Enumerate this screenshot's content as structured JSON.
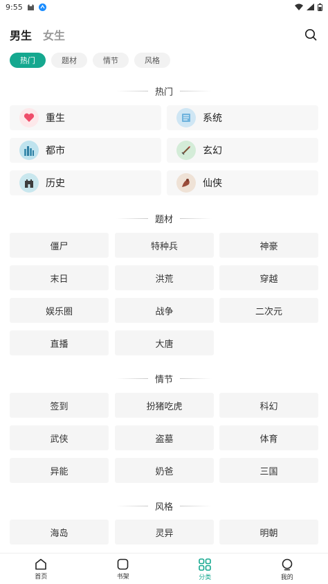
{
  "status": {
    "time": "9:55"
  },
  "gender_tabs": [
    {
      "label": "男生",
      "active": true
    },
    {
      "label": "女生",
      "active": false
    }
  ],
  "category_chips": [
    {
      "label": "热门",
      "active": true
    },
    {
      "label": "题材",
      "active": false
    },
    {
      "label": "情节",
      "active": false
    },
    {
      "label": "风格",
      "active": false
    }
  ],
  "sections": {
    "hot": {
      "title": "热门",
      "items": [
        "重生",
        "系统",
        "都市",
        "玄幻",
        "历史",
        "仙侠"
      ]
    },
    "theme": {
      "title": "题材",
      "items": [
        "僵尸",
        "特种兵",
        "神豪",
        "末日",
        "洪荒",
        "穿越",
        "娱乐圈",
        "战争",
        "二次元",
        "直播",
        "大唐"
      ]
    },
    "plot": {
      "title": "情节",
      "items": [
        "签到",
        "扮猪吃虎",
        "科幻",
        "武侠",
        "盗墓",
        "体育",
        "异能",
        "奶爸",
        "三国"
      ]
    },
    "style": {
      "title": "风格",
      "items": [
        "海岛",
        "灵异",
        "明朝"
      ]
    }
  },
  "tabbar": [
    {
      "label": "首页",
      "icon": "home-icon"
    },
    {
      "label": "书架",
      "icon": "bookshelf-icon"
    },
    {
      "label": "分类",
      "icon": "category-grid-icon",
      "active": true
    },
    {
      "label": "我的",
      "icon": "profile-icon"
    }
  ],
  "colors": {
    "accent": "#15a88f",
    "card_bg": "#f5f5f5"
  }
}
